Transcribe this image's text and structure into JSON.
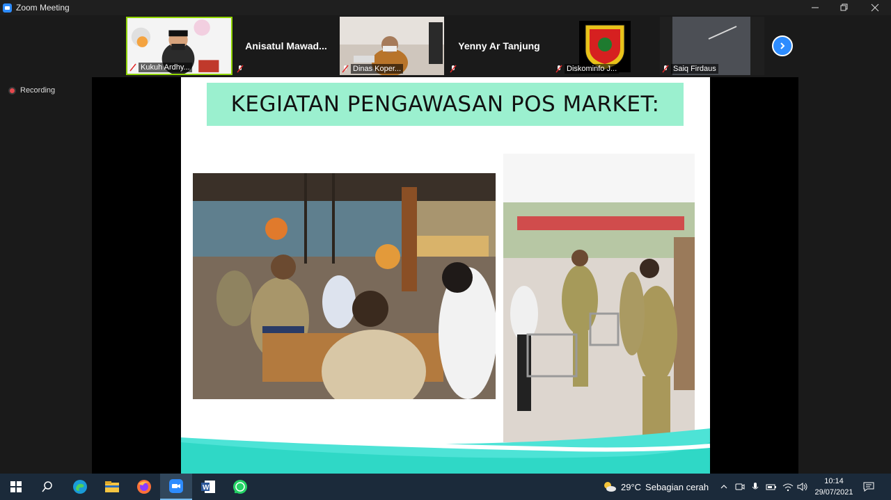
{
  "window": {
    "title": "Zoom Meeting"
  },
  "participants": [
    {
      "name": "Kukuh Ardhy..."
    },
    {
      "name": "Anisatul  Mawad..."
    },
    {
      "name": "Dinas Koper..."
    },
    {
      "name": "Yenny Ar Tanjung"
    },
    {
      "name": "Diskominfo J..."
    },
    {
      "name": "Saiq Firdaus"
    }
  ],
  "recording": {
    "label": "Recording"
  },
  "slide": {
    "title": "KEGIATAN PENGAWASAN POS MARKET:"
  },
  "taskbar": {
    "weather_temp": "29°C",
    "weather_desc": "Sebagian cerah",
    "time": "10:14",
    "date": "29/07/2021"
  },
  "colors": {
    "accent": "#2d8cff",
    "slide_title_bg": "#9bf0cf",
    "slide_wave": "#4de3d6",
    "taskbar": "#1b2a3a"
  }
}
